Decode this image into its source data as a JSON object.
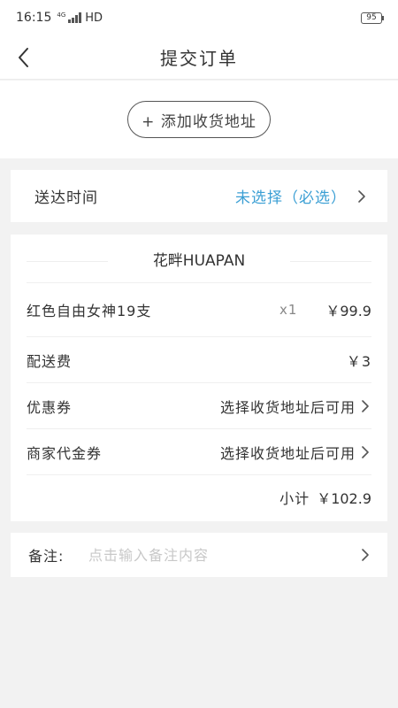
{
  "status_bar": {
    "time": "16:15",
    "network": "4G",
    "hd": "HD",
    "battery": "95"
  },
  "header": {
    "title": "提交订单",
    "back_icon": "chevron-left-icon"
  },
  "address": {
    "add_label": "+ 添加收货地址"
  },
  "delivery": {
    "label": "送达时间",
    "value": "未选择（必选）",
    "value_color": "#3b9fd4"
  },
  "order": {
    "store_name": "花畔HUAPAN",
    "product": {
      "name": "红色自由女神19支",
      "qty": "x1",
      "price": "￥99.9"
    },
    "shipping": {
      "label": "配送费",
      "value": "￥3"
    },
    "coupon": {
      "label": "优惠券",
      "value": "选择收货地址后可用"
    },
    "merchant_coupon": {
      "label": "商家代金券",
      "value": "选择收货地址后可用"
    },
    "subtotal": {
      "label": "小计",
      "value": "￥102.9"
    }
  },
  "note": {
    "label": "备注:",
    "placeholder": "点击输入备注内容"
  },
  "colors": {
    "background": "#f2f2f2",
    "card": "#ffffff",
    "accent": "#3b9fd4"
  }
}
